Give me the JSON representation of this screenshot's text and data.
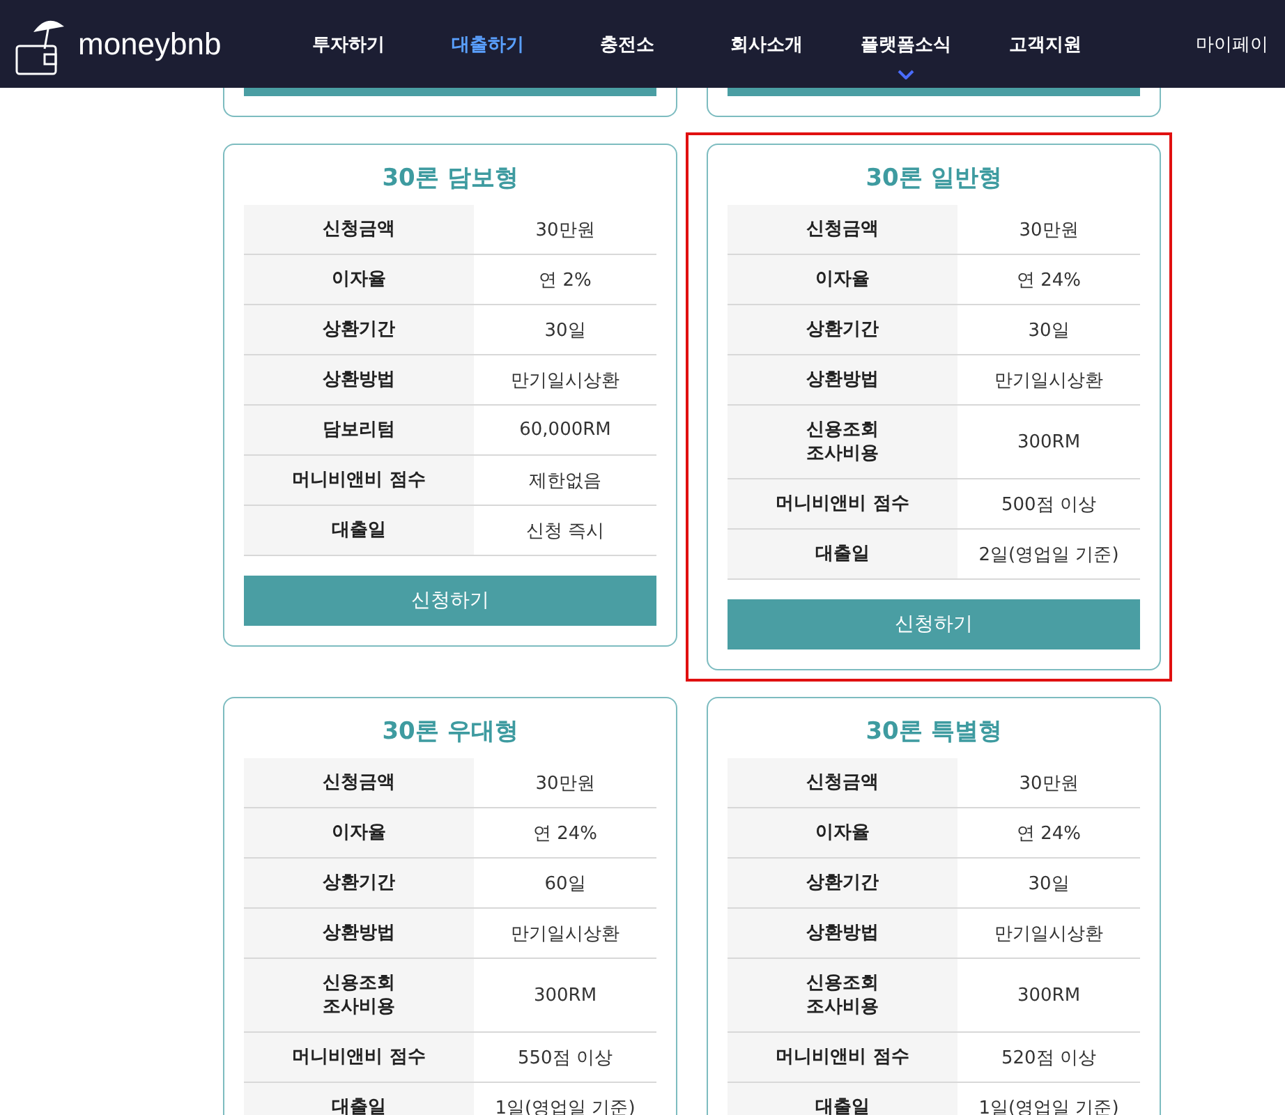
{
  "header": {
    "logo": "moneybnb",
    "nav": [
      {
        "label": "투자하기",
        "selected": false,
        "dropdown": false
      },
      {
        "label": "대출하기",
        "selected": true,
        "dropdown": false
      },
      {
        "label": "충전소",
        "selected": false,
        "dropdown": false
      },
      {
        "label": "회사소개",
        "selected": false,
        "dropdown": false
      },
      {
        "label": "플랫폼소식",
        "selected": false,
        "dropdown": true
      },
      {
        "label": "고객지원",
        "selected": false,
        "dropdown": false
      }
    ],
    "mypage": "마이페이"
  },
  "cards": [
    {
      "kind": "stub"
    },
    {
      "kind": "stub"
    },
    {
      "kind": "full",
      "title": "30론 담보형",
      "rows": [
        {
          "label": "신청금액",
          "value": "30만원"
        },
        {
          "label": "이자율",
          "value": "연 2%"
        },
        {
          "label": "상환기간",
          "value": "30일"
        },
        {
          "label": "상환방법",
          "value": "만기일시상환"
        },
        {
          "label": "담보리텀",
          "value": "60,000RM"
        },
        {
          "label": "머니비앤비 점수",
          "value": "제한없음"
        },
        {
          "label": "대출일",
          "value": "신청 즉시"
        }
      ],
      "button": "신청하기"
    },
    {
      "kind": "full",
      "highlighted": true,
      "title": "30론 일반형",
      "rows": [
        {
          "label": "신청금액",
          "value": "30만원"
        },
        {
          "label": "이자율",
          "value": "연 24%"
        },
        {
          "label": "상환기간",
          "value": "30일"
        },
        {
          "label": "상환방법",
          "value": "만기일시상환"
        },
        {
          "label": "신용조회\n조사비용",
          "value": "300RM"
        },
        {
          "label": "머니비앤비 점수",
          "value": "500점 이상"
        },
        {
          "label": "대출일",
          "value": "2일(영업일 기준)"
        }
      ],
      "button": "신청하기"
    },
    {
      "kind": "full",
      "title": "30론 우대형",
      "rows": [
        {
          "label": "신청금액",
          "value": "30만원"
        },
        {
          "label": "이자율",
          "value": "연 24%"
        },
        {
          "label": "상환기간",
          "value": "60일"
        },
        {
          "label": "상환방법",
          "value": "만기일시상환"
        },
        {
          "label": "신용조회\n조사비용",
          "value": "300RM"
        },
        {
          "label": "머니비앤비 점수",
          "value": "550점 이상"
        },
        {
          "label": "대출일",
          "value": "1일(영업일 기준)"
        }
      ]
    },
    {
      "kind": "full",
      "title": "30론 특별형",
      "rows": [
        {
          "label": "신청금액",
          "value": "30만원"
        },
        {
          "label": "이자율",
          "value": "연 24%"
        },
        {
          "label": "상환기간",
          "value": "30일"
        },
        {
          "label": "상환방법",
          "value": "만기일시상환"
        },
        {
          "label": "신용조회\n조사비용",
          "value": "300RM"
        },
        {
          "label": "머니비앤비 점수",
          "value": "520점 이상"
        },
        {
          "label": "대출일",
          "value": "1일(영업일 기준)"
        }
      ]
    }
  ]
}
